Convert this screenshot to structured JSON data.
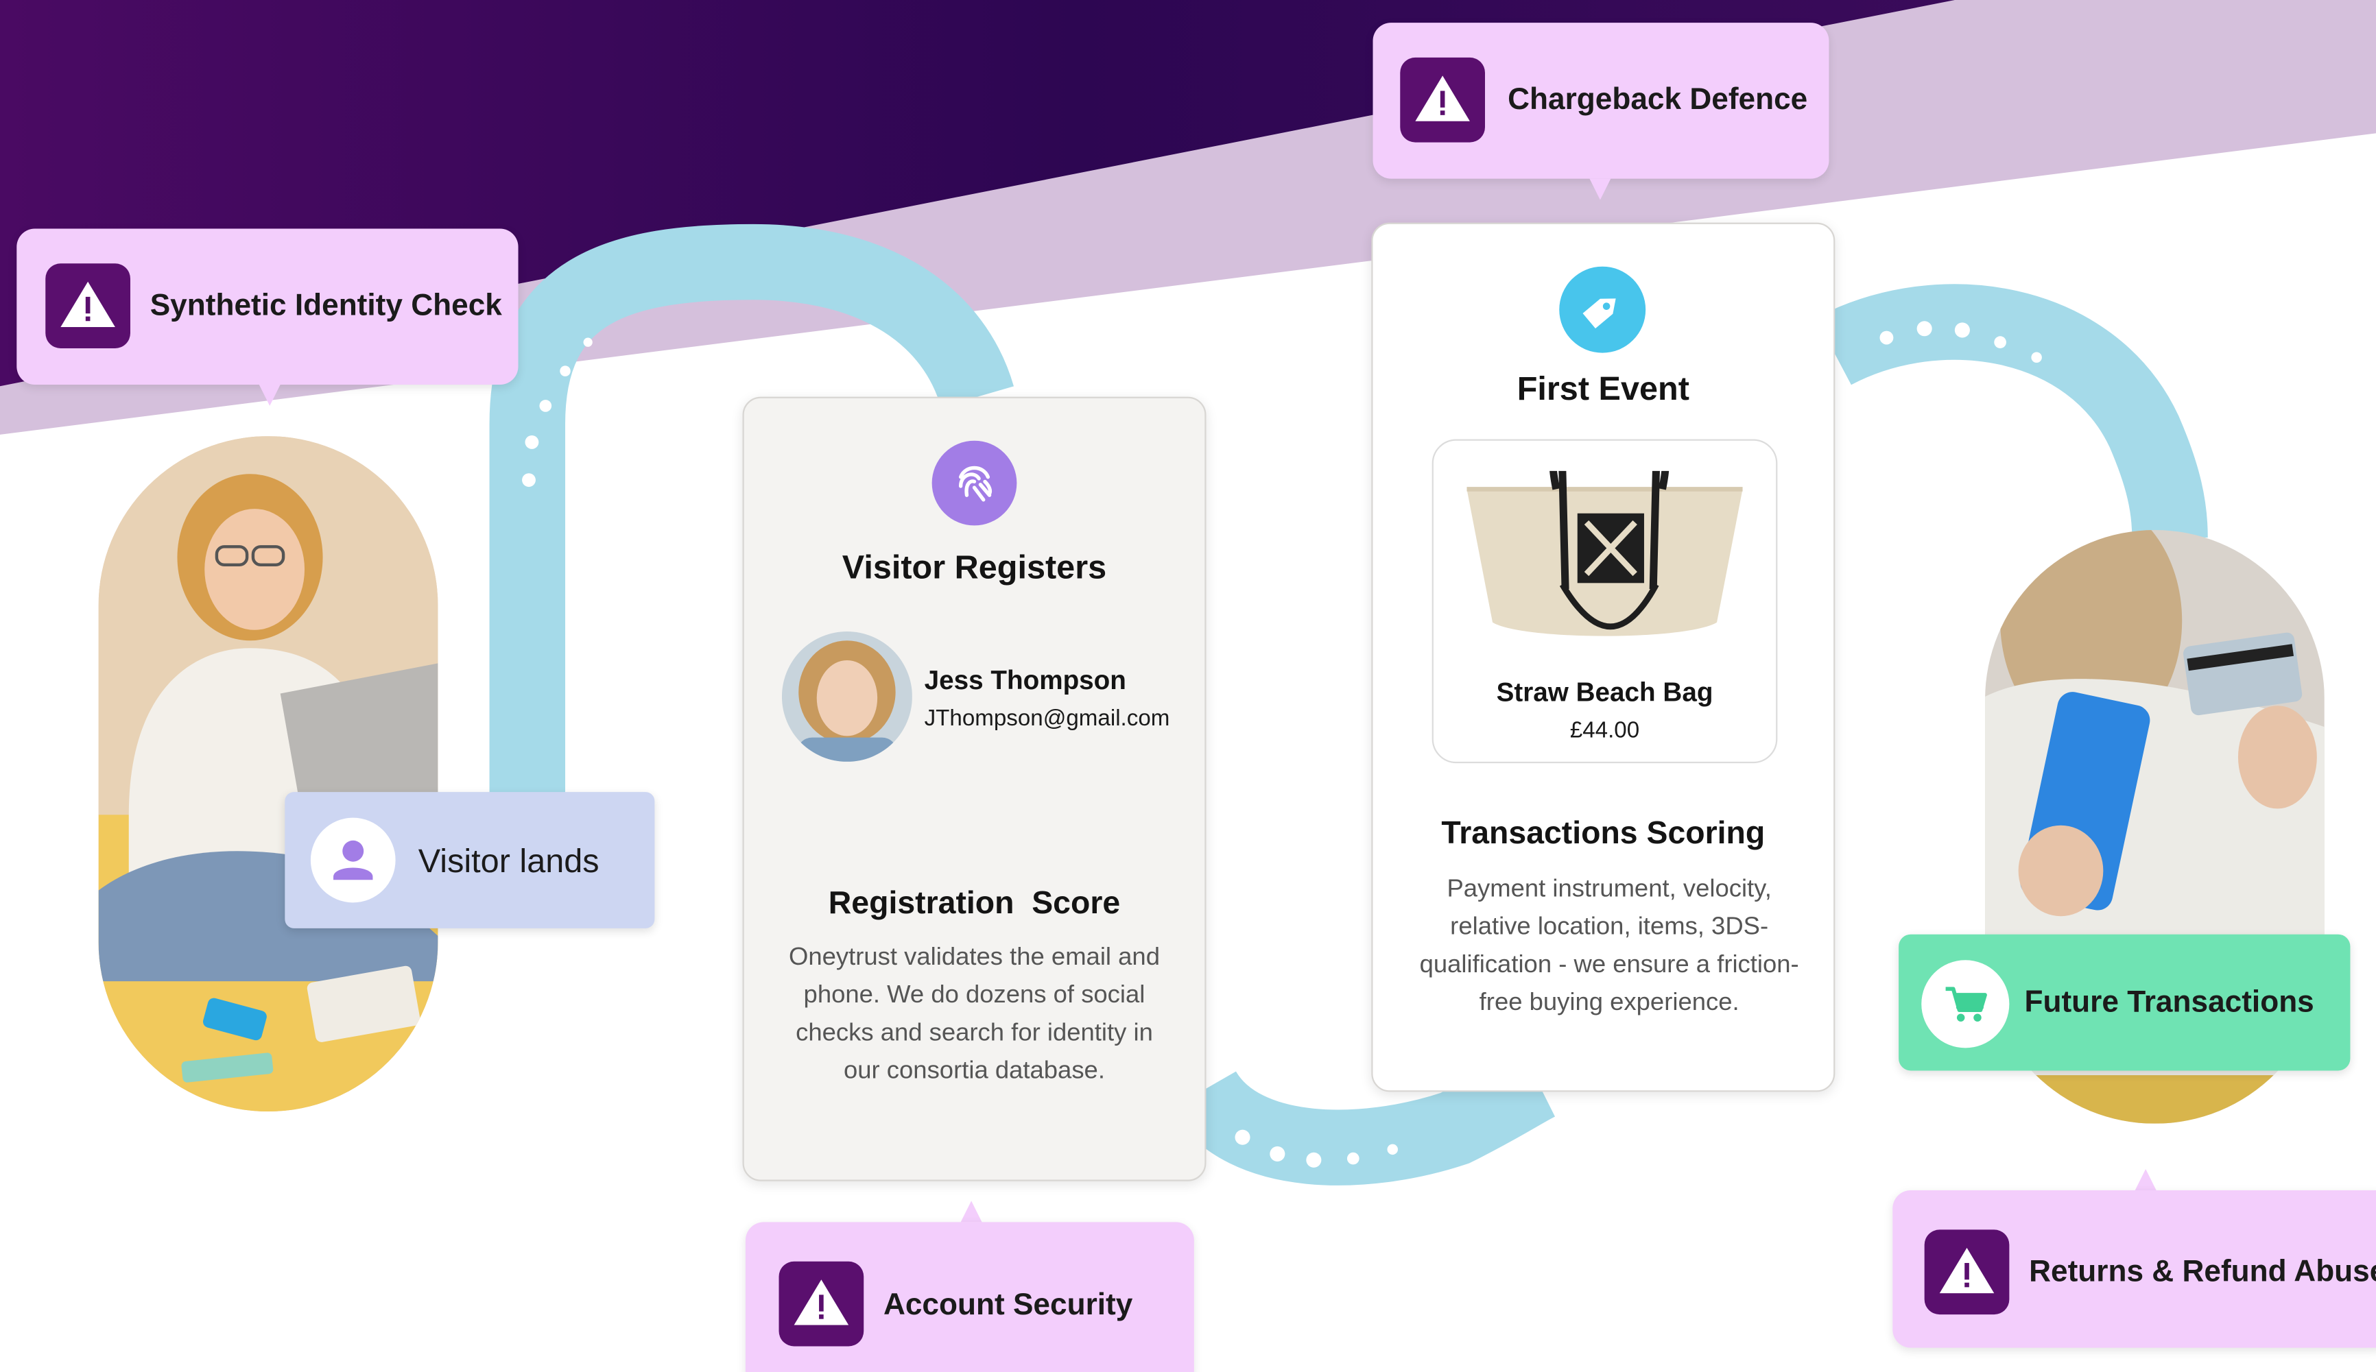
{
  "colors": {
    "callout_bg": "#f3cefc",
    "warning_icon": "#5a0f6e",
    "path": "#a5dae9",
    "visitor_lands_bg": "#cdd6f2",
    "future_bg": "#6fe3b3",
    "hero_dark": "#33064f"
  },
  "callouts": {
    "synthetic": {
      "label": "Synthetic Identity Check",
      "icon": "warning-icon"
    },
    "chargeback": {
      "label": "Chargeback Defence",
      "icon": "warning-icon"
    },
    "account": {
      "label": "Account Security",
      "icon": "warning-icon"
    },
    "returns": {
      "label": "Returns & Refund Abuse",
      "icon": "warning-icon"
    }
  },
  "visitor_lands": {
    "label": "Visitor lands",
    "icon": "user-icon"
  },
  "registers": {
    "title": "Visitor Registers",
    "icon": "fingerprint-icon",
    "user_name": "Jess Thompson",
    "user_email": "JThompson@gmail.com",
    "score_title": "Registration  Score",
    "score_text": "Oneytrust validates the email and phone. We do dozens of social checks and search for identity in our consortia database."
  },
  "first_event": {
    "title": "First Event",
    "icon": "tag-icon",
    "product_name": "Straw Beach Bag",
    "product_price": "£44.00",
    "scoring_title": "Transactions Scoring",
    "scoring_text": "Payment instrument, velocity, relative location, items, 3DS-qualification - we ensure a friction-free buying experience."
  },
  "future": {
    "label": "Future Transactions",
    "icon": "cart-icon"
  }
}
